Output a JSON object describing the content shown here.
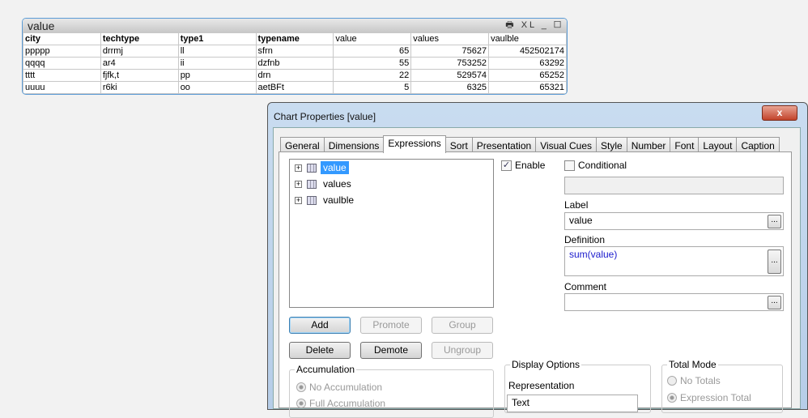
{
  "table": {
    "title": "value",
    "controls": "XL",
    "headers": [
      "city",
      "techtype",
      "type1",
      "typename",
      "value",
      "values",
      "vaulble"
    ],
    "rows": [
      [
        "ppppp",
        "drrmj",
        "ll",
        "sfrn",
        "65",
        "75627",
        "452502174"
      ],
      [
        "qqqq",
        "ar4",
        "ii",
        "dzfnb",
        "55",
        "753252",
        "63292"
      ],
      [
        "tttt",
        "fjfk,t",
        "pp",
        "drn",
        "22",
        "529574",
        "65252"
      ],
      [
        "uuuu",
        "r6ki",
        "oo",
        "aetBFt",
        "5",
        "6325",
        "65321"
      ]
    ]
  },
  "dialog": {
    "title": "Chart Properties [value]",
    "close": "x",
    "tabs": [
      "General",
      "Dimensions",
      "Expressions",
      "Sort",
      "Presentation",
      "Visual Cues",
      "Style",
      "Number",
      "Font",
      "Layout",
      "Caption"
    ],
    "expressions": [
      "value",
      "values",
      "vaulble"
    ],
    "enable": "Enable",
    "conditional": "Conditional",
    "label_caption": "Label",
    "label_value": "value",
    "definition_caption": "Definition",
    "definition_func": "sum",
    "definition_arg": "(value)",
    "comment_caption": "Comment",
    "dots": "...",
    "buttons": {
      "add": "Add",
      "promote": "Promote",
      "group": "Group",
      "delete": "Delete",
      "demote": "Demote",
      "ungroup": "Ungroup"
    },
    "accumulation": {
      "title": "Accumulation",
      "opt1": "No Accumulation",
      "opt2": "Full Accumulation"
    },
    "display": {
      "title": "Display Options",
      "representation": "Representation",
      "value": "Text"
    },
    "total": {
      "title": "Total Mode",
      "opt1": "No Totals",
      "opt2": "Expression Total"
    }
  }
}
